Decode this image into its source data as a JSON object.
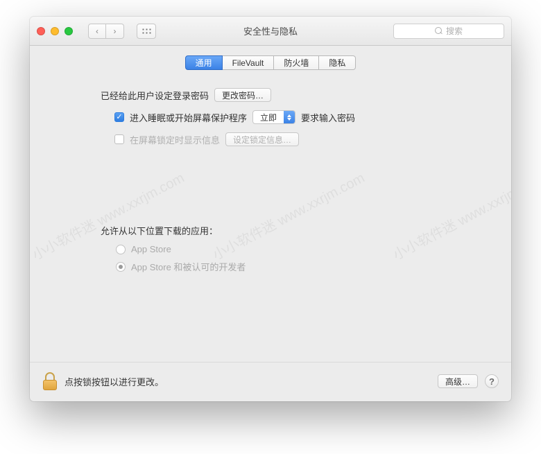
{
  "window": {
    "title": "安全性与隐私",
    "search_placeholder": "搜索"
  },
  "tabs": [
    {
      "id": "general",
      "label": "通用",
      "active": true
    },
    {
      "id": "filevault",
      "label": "FileVault",
      "active": false
    },
    {
      "id": "firewall",
      "label": "防火墙",
      "active": false
    },
    {
      "id": "privacy",
      "label": "隐私",
      "active": false
    }
  ],
  "general": {
    "login_password_set_label": "已经给此用户设定登录密码",
    "change_password_button": "更改密码…",
    "require_password": {
      "checked": true,
      "prefix_label": "进入睡眠或开始屏幕保护程序",
      "select_value": "立即",
      "suffix_label": "要求输入密码"
    },
    "show_lock_message": {
      "checked": false,
      "label": "在屏幕锁定时显示信息",
      "set_message_button": "设定锁定信息…",
      "button_enabled": false
    },
    "allow_downloads_title": "允许从以下位置下载的应用：",
    "allow_downloads_enabled": false,
    "allow_downloads_options": [
      {
        "id": "appstore",
        "label": "App Store",
        "selected": false
      },
      {
        "id": "appstore_identified",
        "label": "App Store 和被认可的开发者",
        "selected": true
      }
    ]
  },
  "footer": {
    "locked": true,
    "lock_text": "点按锁按钮以进行更改。",
    "advanced_button": "高级…"
  },
  "watermark_text": "小小软件迷 www.xxrjm.com"
}
